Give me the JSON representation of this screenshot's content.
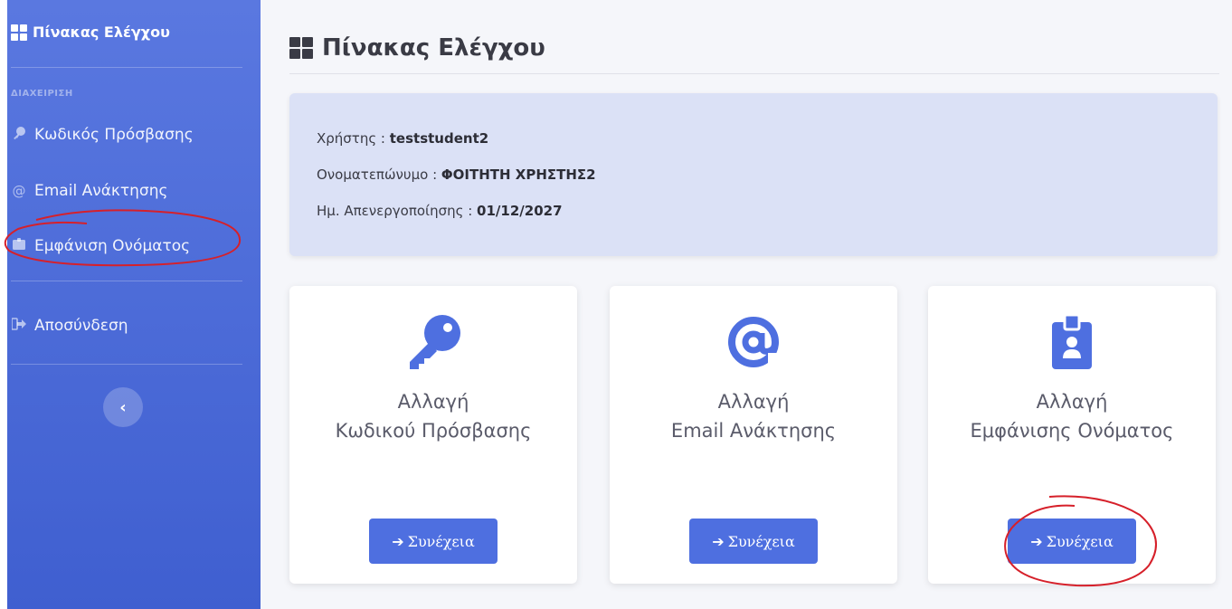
{
  "sidebar": {
    "brand": "Πίνακας Ελέγχου",
    "section_label": "ΔΙΑΧΕΙΡΙΣΗ",
    "items": [
      {
        "label": "Κωδικός Πρόσβασης",
        "icon": "key-icon"
      },
      {
        "label": "Email Ανάκτησης",
        "icon": "at-icon"
      },
      {
        "label": "Εμφάνιση Ονόματος",
        "icon": "id-badge-icon"
      }
    ],
    "logout": {
      "label": "Αποσύνδεση",
      "icon": "sign-out-icon"
    },
    "collapse": "‹"
  },
  "main": {
    "title": "Πίνακας Ελέγχου",
    "info": {
      "user_label": "Χρήστης :",
      "user_value": "teststudent2",
      "name_label": "Ονοματεπώνυμο :",
      "name_value": "ΦΟΙΤΗΤΗ ΧΡΗΣΤΗΣ2",
      "deactivation_label": "Ημ. Απενεργοποίησης :",
      "deactivation_value": "01/12/2027"
    },
    "cards": [
      {
        "line1": "Αλλαγή",
        "line2": "Κωδικού Πρόσβασης",
        "button": "Συνέχεια",
        "icon": "key-icon"
      },
      {
        "line1": "Αλλαγή",
        "line2": "Email Ανάκτησης",
        "button": "Συνέχεια",
        "icon": "at-icon"
      },
      {
        "line1": "Αλλαγή",
        "line2": "Εμφάνισης Ονόματος",
        "button": "Συνέχεια",
        "icon": "id-badge-icon"
      }
    ]
  },
  "colors": {
    "sidebar_top": "#5a78e0",
    "sidebar_bottom": "#3f5fd0",
    "accent": "#4e6fe0",
    "info_bg": "#dbe1f6",
    "annotation": "#d6202a"
  }
}
